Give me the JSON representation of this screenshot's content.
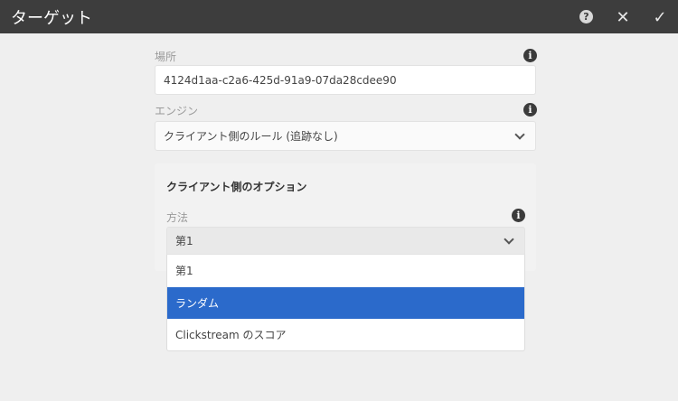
{
  "header": {
    "title": "ターゲット",
    "help_icon": "question-circle-icon",
    "close_icon": "close-icon",
    "confirm_icon": "checkmark-icon"
  },
  "location": {
    "label": "場所",
    "value": "4124d1aa-c2a6-425d-91a9-07da28cdee90"
  },
  "engine": {
    "label": "エンジン",
    "value": "クライアント側のルール (追跡なし)"
  },
  "client_options": {
    "title": "クライアント側のオプション",
    "method_label": "方法",
    "method_value": "第1",
    "options": [
      {
        "label": "第1",
        "selected": false
      },
      {
        "label": "ランダム",
        "selected": true
      },
      {
        "label": "Clickstream のスコア",
        "selected": false
      }
    ]
  },
  "colors": {
    "header": "#3d3d3d",
    "highlight": "#2b6acb"
  }
}
